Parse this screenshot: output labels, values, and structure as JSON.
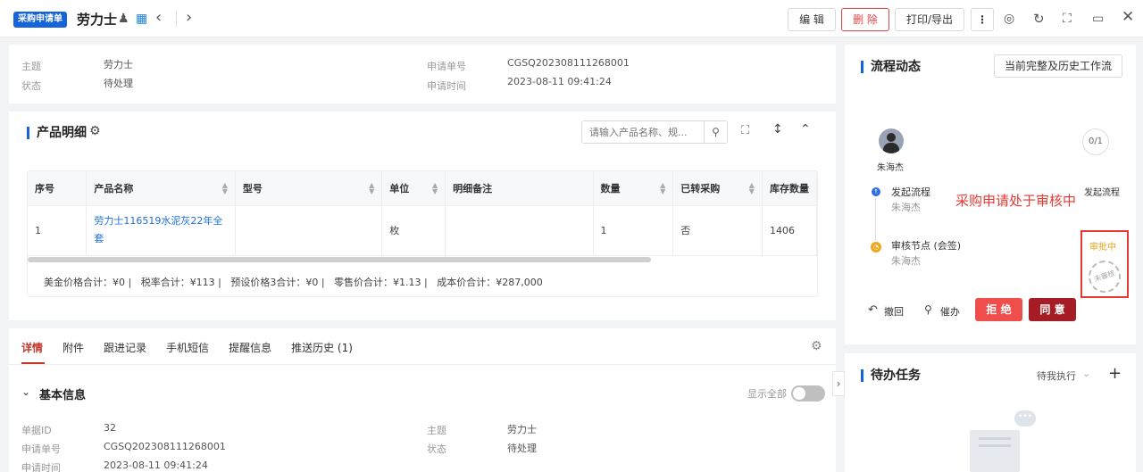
{
  "header": {
    "badge": "采购申请单",
    "title": "劳力士",
    "edit_label": "编 辑",
    "delete_label": "删 除",
    "print_label": "打印/导出",
    "more_label": "⋮"
  },
  "summary": {
    "subject_label": "主题",
    "subject_value": "劳力士",
    "status_label": "状态",
    "status_value": "待处理",
    "no_label": "申请单号",
    "no_value": "CGSQ202308111268001",
    "time_label": "申请时间",
    "time_value": "2023-08-11 09:41:24"
  },
  "products": {
    "title": "产品明细",
    "search_placeholder": "请输入产品名称、规...",
    "columns": [
      "序号",
      "产品名称",
      "型号",
      "单位",
      "明细备注",
      "数量",
      "已转采购",
      "库存数量"
    ],
    "rows": [
      [
        "1",
        "劳力士116519水泥灰22年全套",
        "",
        "枚",
        "",
        "1",
        "否",
        "1406"
      ]
    ],
    "totals": "美金价格合计：¥0 |   税率合计：¥113 |   预设价格3合计：¥0 |   零售价合计：¥1.13 |   成本价合计：¥287,000"
  },
  "tabs": {
    "items": [
      "详情",
      "附件",
      "跟进记录",
      "手机短信",
      "提醒信息",
      "推送历史 (1)"
    ]
  },
  "basic": {
    "title": "基本信息",
    "show_all": "显示全部",
    "id_label": "单据ID",
    "id_value": "32",
    "no_label": "申请单号",
    "no_value": "CGSQ202308111268001",
    "time_label": "申请时间",
    "time_value": "2023-08-11 09:41:24",
    "subject_label": "主题",
    "subject_value": "劳力士",
    "status_label": "状态",
    "status_value": "待处理"
  },
  "flow": {
    "title": "流程动态",
    "history_btn": "当前完整及历史工作流",
    "user_name": "朱海杰",
    "progress": "0/1",
    "step1_title": "发起流程",
    "step1_user": "朱海杰",
    "step1_status": "发起流程",
    "annotation": "采购申请处于审核中",
    "step2_title": "审核节点 (会签)",
    "step2_user": "朱海杰",
    "step2_status": "审批中",
    "stamp_text": "未審核",
    "revoke": "撤回",
    "urge": "催办",
    "reject": "拒 绝",
    "agree": "同 意"
  },
  "todo": {
    "title": "待办任务",
    "filter": "待我执行",
    "add": "+"
  },
  "colors": {
    "accent": "#1565d8",
    "danger": "#f04d4d",
    "agree": "#a51c24",
    "highlight": "#e53935"
  }
}
